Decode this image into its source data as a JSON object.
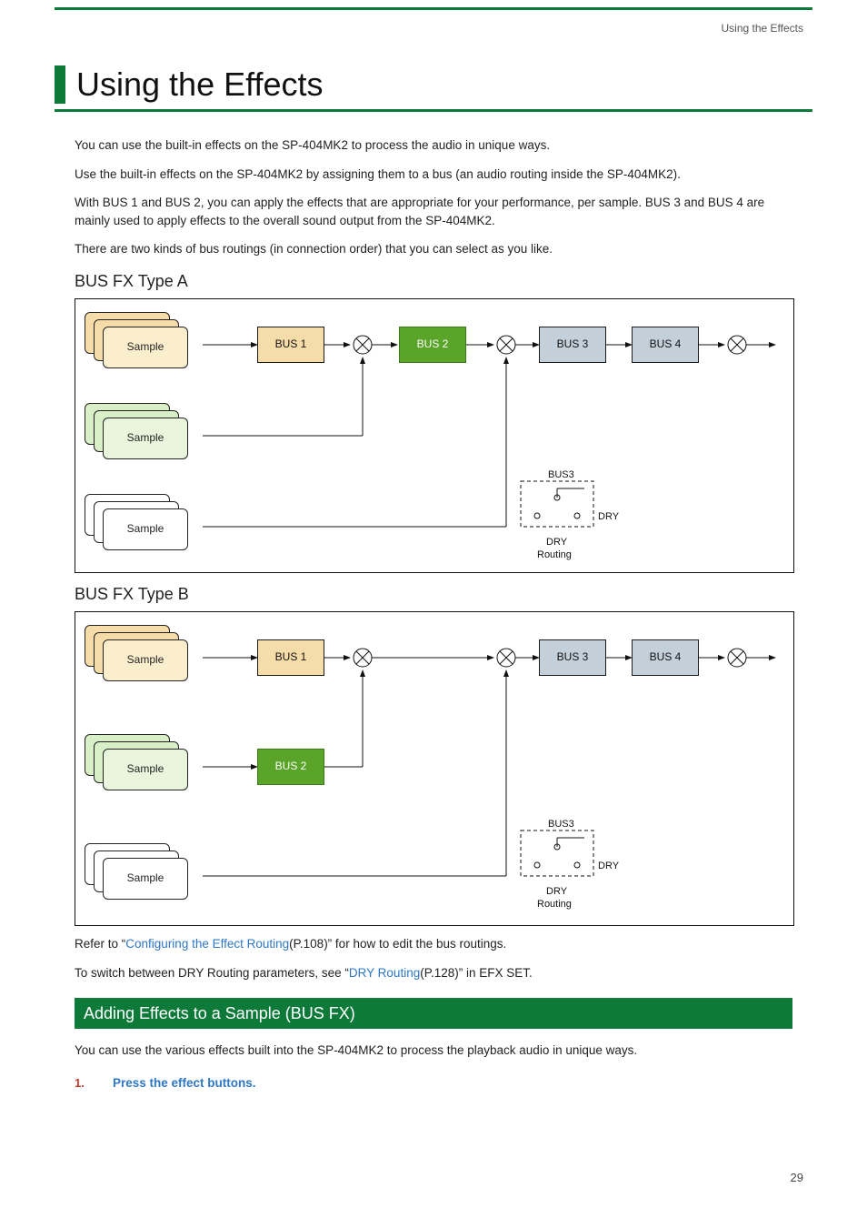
{
  "running_head": "Using the Effects",
  "page_title": "Using the Effects",
  "intro": {
    "p1": "You can use the built-in effects on the SP-404MK2 to process the audio in unique ways.",
    "p2": "Use the built-in effects on the SP-404MK2 by assigning them to a bus (an audio routing inside the SP-404MK2).",
    "p3": "With BUS 1 and BUS 2, you can apply the effects that are appropriate for your performance, per sample. BUS 3 and BUS 4 are mainly used to apply effects to the overall sound output from the SP-404MK2.",
    "p4": "There are two kinds of bus routings (in connection order) that you can select as you like."
  },
  "diagrams": {
    "typeA": {
      "title": "BUS FX Type A",
      "labels": {
        "sample": "Sample",
        "bus1": "BUS 1",
        "bus2": "BUS 2",
        "bus3": "BUS 3",
        "bus4": "BUS 4",
        "bus3_tag": "BUS3",
        "dry": "DRY",
        "dry_routing_l1": "DRY",
        "dry_routing_l2": "Routing"
      }
    },
    "typeB": {
      "title": "BUS FX Type B",
      "labels": {
        "sample": "Sample",
        "bus1": "BUS 1",
        "bus2": "BUS 2",
        "bus3": "BUS 3",
        "bus4": "BUS 4",
        "bus3_tag": "BUS3",
        "dry": "DRY",
        "dry_routing_l1": "DRY",
        "dry_routing_l2": "Routing"
      }
    }
  },
  "refs": {
    "r1_pre": "Refer to “",
    "r1_link": "Configuring the Effect Routing",
    "r1_post": "(P.108)” for how to edit the bus routings.",
    "r2_pre": "To switch between DRY Routing parameters, see “",
    "r2_link": "DRY Routing",
    "r2_post": "(P.128)” in EFX SET."
  },
  "section2": {
    "banner": "Adding Effects to a Sample (BUS FX)",
    "p1": "You can use the various effects built into the SP-404MK2 to process the playback audio in unique ways.",
    "step1_num": "1.",
    "step1_text": "Press the effect buttons."
  },
  "page_number": "29"
}
